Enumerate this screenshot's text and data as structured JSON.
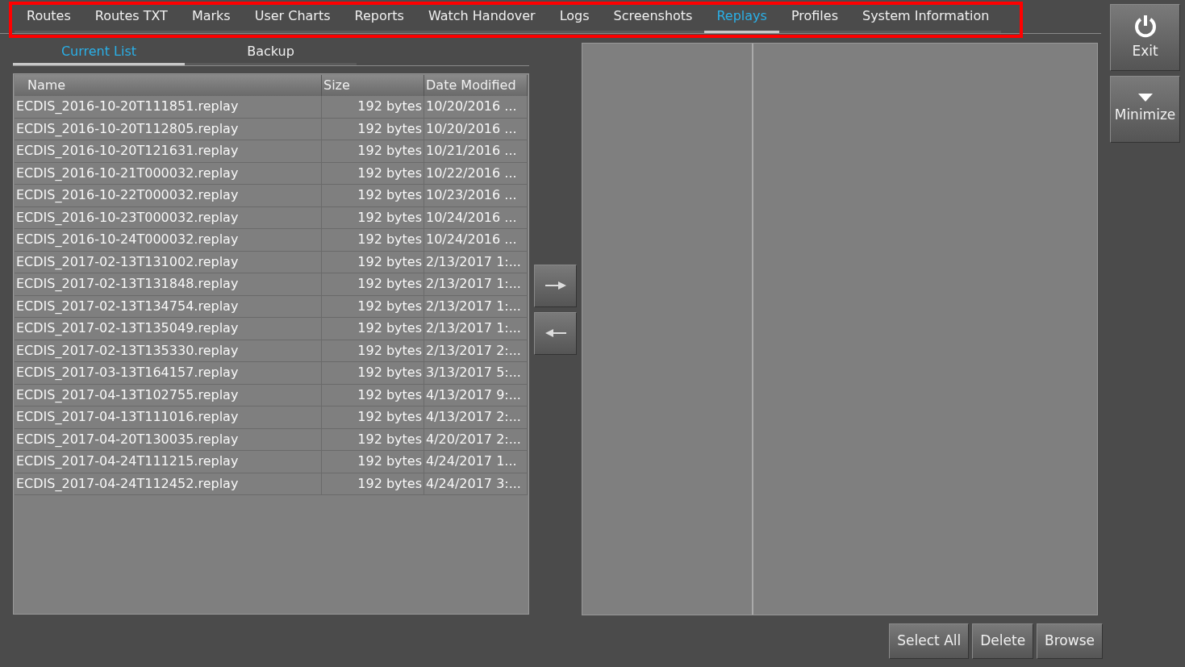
{
  "tabs": [
    {
      "label": "Routes",
      "selected": false
    },
    {
      "label": "Routes TXT",
      "selected": false
    },
    {
      "label": "Marks",
      "selected": false
    },
    {
      "label": "User Charts",
      "selected": false
    },
    {
      "label": "Reports",
      "selected": false
    },
    {
      "label": "Watch Handover",
      "selected": false
    },
    {
      "label": "Logs",
      "selected": false
    },
    {
      "label": "Screenshots",
      "selected": false
    },
    {
      "label": "Replays",
      "selected": true
    },
    {
      "label": "Profiles",
      "selected": false
    },
    {
      "label": "System Information",
      "selected": false
    }
  ],
  "subtabs": [
    {
      "label": "Current List",
      "selected": true
    },
    {
      "label": "Backup",
      "selected": false
    }
  ],
  "table": {
    "columns": [
      "Name",
      "Size",
      "Date Modified"
    ],
    "rows": [
      [
        "ECDIS_2016-10-20T111851.replay",
        "192 bytes",
        "10/20/2016 ..."
      ],
      [
        "ECDIS_2016-10-20T112805.replay",
        "192 bytes",
        "10/20/2016 ..."
      ],
      [
        "ECDIS_2016-10-20T121631.replay",
        "192 bytes",
        "10/21/2016 ..."
      ],
      [
        "ECDIS_2016-10-21T000032.replay",
        "192 bytes",
        "10/22/2016 ..."
      ],
      [
        "ECDIS_2016-10-22T000032.replay",
        "192 bytes",
        "10/23/2016 ..."
      ],
      [
        "ECDIS_2016-10-23T000032.replay",
        "192 bytes",
        "10/24/2016 ..."
      ],
      [
        "ECDIS_2016-10-24T000032.replay",
        "192 bytes",
        "10/24/2016 ..."
      ],
      [
        "ECDIS_2017-02-13T131002.replay",
        "192 bytes",
        "2/13/2017 1:..."
      ],
      [
        "ECDIS_2017-02-13T131848.replay",
        "192 bytes",
        "2/13/2017 1:..."
      ],
      [
        "ECDIS_2017-02-13T134754.replay",
        "192 bytes",
        "2/13/2017 1:..."
      ],
      [
        "ECDIS_2017-02-13T135049.replay",
        "192 bytes",
        "2/13/2017 1:..."
      ],
      [
        "ECDIS_2017-02-13T135330.replay",
        "192 bytes",
        "2/13/2017 2:..."
      ],
      [
        "ECDIS_2017-03-13T164157.replay",
        "192 bytes",
        "3/13/2017 5:..."
      ],
      [
        "ECDIS_2017-04-13T102755.replay",
        "192 bytes",
        "4/13/2017 9:..."
      ],
      [
        "ECDIS_2017-04-13T111016.replay",
        "192 bytes",
        "4/13/2017 2:..."
      ],
      [
        "ECDIS_2017-04-20T130035.replay",
        "192 bytes",
        "4/20/2017 2:..."
      ],
      [
        "ECDIS_2017-04-24T111215.replay",
        "192 bytes",
        "4/24/2017 1..."
      ],
      [
        "ECDIS_2017-04-24T112452.replay",
        "192 bytes",
        "4/24/2017 3:..."
      ]
    ]
  },
  "side_buttons": [
    "Exit",
    "Minimize"
  ],
  "bottom_buttons": [
    "Select All",
    "Delete",
    "Browse"
  ]
}
